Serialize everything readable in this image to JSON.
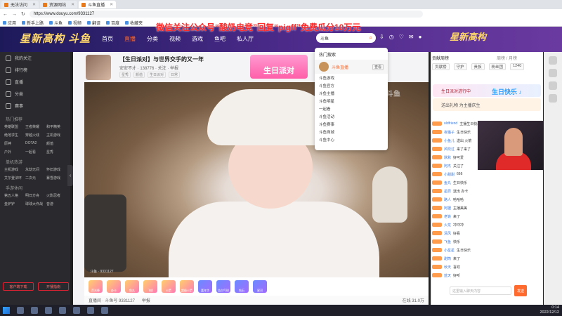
{
  "browser": {
    "tabs": [
      {
        "label": "无法访问",
        "active": false
      },
      {
        "label": "资源网站",
        "active": false
      },
      {
        "label": "斗鱼直播",
        "active": true
      }
    ],
    "url": "https://www.douyu.com/9331127",
    "bookmarks": [
      "应用",
      "新手上路",
      "斗鱼",
      "视频",
      "翻译",
      "百度",
      "收藏夹"
    ]
  },
  "promo_text": "微信关注公众号“酸奶电竞”回复“pigff”免费瓜分10万元",
  "site": {
    "logo_text": "星新高构 斗鱼",
    "nav": [
      "首页",
      "直播",
      "分类",
      "视频",
      "游戏",
      "鱼吧",
      "私人厅"
    ],
    "nav_current": 1,
    "search_value": "斗鱼",
    "brand_right": "星新高构"
  },
  "sidebar": {
    "items": [
      "我的关注",
      "排行榜",
      "直播",
      "分类",
      "赛事"
    ],
    "sec_hot": "热门推荐",
    "hot": [
      "英雄联盟",
      "王者荣耀",
      "和平精英",
      "绝地求生",
      "穿越火线",
      "主机游戏",
      "原神",
      "DOTA2",
      "颜值",
      "户外",
      "一起看",
      "星秀"
    ],
    "sec_games": "单机热游",
    "games": [
      "主机游戏",
      "永劫无间",
      "怀旧游戏",
      "艾尔登法环",
      "二次元",
      "暴雪游戏"
    ],
    "sec_play": "手游休闲",
    "plays": [
      "第五人格",
      "明日方舟",
      "火影忍者",
      "金铲铲",
      "球球大作战",
      "音游"
    ],
    "btn_left": "客户端下载",
    "btn_right": "开播指南"
  },
  "room": {
    "title": "【生日派对】与世界交手的又一年",
    "anchor": "安安不才",
    "meta": "安安不才 · 138776 · 关注 · 举报",
    "tags": [
      "星秀",
      "颜值",
      "生日派对",
      "日常"
    ],
    "banner": "生日派对",
    "watermark": "斗鱼",
    "vid_info": "斗鱼 · 9331127"
  },
  "gifts": [
    "荧光棒",
    "办卡",
    "鱼丸",
    "飞机",
    "火箭",
    "超级火箭",
    "嘉年华",
    "告白气球",
    "钻石",
    "星河"
  ],
  "bottom": {
    "left": "直播间 · 斗鱼号 9331127",
    "mid": "举报",
    "right": "在线 31.0万"
  },
  "dropdown": {
    "head": "热门搜索",
    "hot_label": "斗鱼直播",
    "hot_button": "查看",
    "items": [
      "斗鱼游戏",
      "斗鱼官方",
      "斗鱼主播",
      "斗鱼明星",
      "一起看",
      "斗鱼活动",
      "斗鱼赛事",
      "斗鱼商城",
      "斗鱼中心"
    ]
  },
  "chat": {
    "rank_label": "贡献周榜",
    "rank_right": "周榜 / 月榜",
    "tabs": [
      "贡献榜",
      "守护",
      "贵族",
      "粉丝团",
      "1240"
    ],
    "banner1": "生日派对进行中",
    "banner2": "送出礼物 为主播庆生",
    "messages": [
      {
        "user": "oldfriend",
        "text": "主播生日快乐"
      },
      {
        "user": "夜猫子",
        "text": "生日快乐"
      },
      {
        "user": "小鱼儿",
        "text": "送出 火箭"
      },
      {
        "user": "风吹过",
        "text": "来了来了"
      },
      {
        "user": "默默",
        "text": "好可爱"
      },
      {
        "user": "阿杰",
        "text": "关注了"
      },
      {
        "user": "小甜甜",
        "text": "666"
      },
      {
        "user": "鱼丸",
        "text": "生日快乐"
      },
      {
        "user": "星辰",
        "text": "送出 办卡"
      },
      {
        "user": "路人",
        "text": "哈哈哈"
      },
      {
        "user": "阿狸",
        "text": "主播美美"
      },
      {
        "user": "老铁",
        "text": "来了"
      },
      {
        "user": "火龙",
        "text": "冲冲冲"
      },
      {
        "user": "清风",
        "text": "好看"
      },
      {
        "user": "飞鱼",
        "text": "快乐"
      },
      {
        "user": "小星星",
        "text": "生日快乐"
      },
      {
        "user": "甜筒",
        "text": "来了"
      },
      {
        "user": "秋天",
        "text": "喜欢"
      },
      {
        "user": "蓝天",
        "text": "好听"
      }
    ],
    "input_placeholder": "这里输入聊天内容",
    "send_label": "发送"
  },
  "overlay_text": "生日快乐 ♪",
  "taskbar": {
    "time": "0:14",
    "date": "2022/12/12"
  },
  "colors": {
    "accent": "#ff6a2e",
    "promo": "#ff2a2a",
    "header": "#4b2a8a"
  }
}
